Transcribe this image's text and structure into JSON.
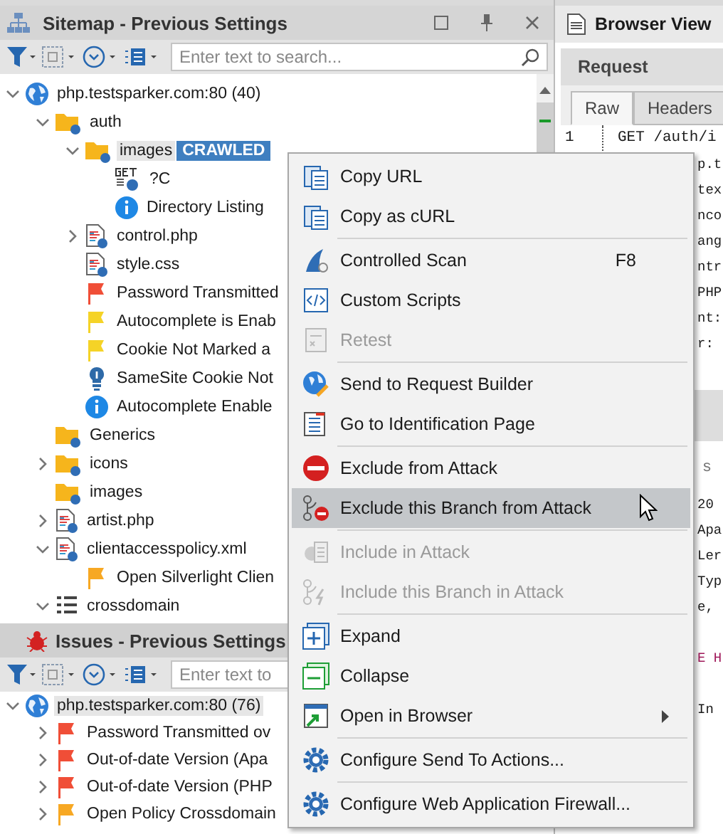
{
  "sitemap": {
    "title": "Sitemap - Previous Settings",
    "search": {
      "placeholder": "Enter text to search..."
    },
    "tree": [
      {
        "label": "php.testsparker.com:80 (40)",
        "kind": "globe",
        "expanded": true,
        "selected": false,
        "children": [
          {
            "label": "auth",
            "kind": "folder",
            "expanded": true,
            "selected": false,
            "children": [
              {
                "label": "images",
                "kind": "folder",
                "expanded": true,
                "selected": true,
                "badge": "CRAWLED",
                "children": [
                  {
                    "label": "?C",
                    "kind": "get",
                    "selected": false
                  },
                  {
                    "label": "Directory Listing",
                    "kind": "info",
                    "selected": false
                  }
                ]
              },
              {
                "label": "control.php",
                "kind": "page",
                "expanded": false,
                "selected": false
              },
              {
                "label": "style.css",
                "kind": "page",
                "selected": false
              },
              {
                "label": "Password Transmitted",
                "kind": "flag",
                "color": "#f04e37",
                "selected": false
              },
              {
                "label": "Autocomplete is Enab",
                "kind": "flag",
                "color": "#f5d327",
                "selected": false
              },
              {
                "label": "Cookie Not Marked a",
                "kind": "flag",
                "color": "#f5d327",
                "selected": false
              },
              {
                "label": "SameSite Cookie Not",
                "kind": "bulb",
                "selected": false
              },
              {
                "label": "Autocomplete Enable",
                "kind": "info",
                "selected": false
              }
            ]
          },
          {
            "label": "Generics",
            "kind": "folder",
            "selected": false
          },
          {
            "label": "icons",
            "kind": "folder",
            "expanded": false,
            "selected": false
          },
          {
            "label": "images",
            "kind": "folder",
            "selected": false
          },
          {
            "label": "artist.php",
            "kind": "page",
            "expanded": false,
            "selected": false
          },
          {
            "label": "clientaccesspolicy.xml",
            "kind": "page",
            "expanded": true,
            "selected": false,
            "children": [
              {
                "label": "Open Silverlight Clien",
                "kind": "flag",
                "color": "#f7a823",
                "selected": false
              }
            ]
          },
          {
            "label": "crossdomain",
            "kind": "list",
            "expanded": true,
            "selected": false
          }
        ]
      }
    ]
  },
  "issues": {
    "title": "Issues - Previous Settings",
    "search": {
      "placeholder": "Enter text to"
    },
    "tree": [
      {
        "label": "php.testsparker.com:80 (76)",
        "kind": "globe",
        "expanded": true,
        "selected": true,
        "children": [
          {
            "label": "Password Transmitted ov",
            "kind": "flag",
            "color": "#f04e37",
            "expanded": false,
            "selected": false
          },
          {
            "label": "Out-of-date Version (Apa",
            "kind": "flag",
            "color": "#f04e37",
            "expanded": false,
            "selected": false
          },
          {
            "label": "Out-of-date Version (PHP",
            "kind": "flag",
            "color": "#f04e37",
            "expanded": false,
            "selected": false
          },
          {
            "label": "Open Policy Crossdomain",
            "kind": "flag",
            "color": "#f7a823",
            "expanded": false,
            "selected": false
          }
        ]
      }
    ]
  },
  "browser": {
    "title": "Browser View",
    "request_title": "Request",
    "tabs": [
      {
        "label": "Raw",
        "selected": true
      },
      {
        "label": "Headers",
        "selected": false
      }
    ],
    "request_lines": [
      {
        "number": "1",
        "text": "GET /auth/i"
      },
      {
        "text": "p.t"
      },
      {
        "text": "tex"
      },
      {
        "text": "nco"
      },
      {
        "text": "ang"
      },
      {
        "text": "ntr"
      },
      {
        "text": "PHP"
      },
      {
        "text": "nt:"
      },
      {
        "text": "r:"
      }
    ],
    "response_search": "s",
    "response_lines": [
      {
        "text": "20"
      },
      {
        "text": "Apa"
      },
      {
        "text": "Ler"
      },
      {
        "text": "Typ"
      },
      {
        "text": "e,"
      },
      {
        "kind": "blank"
      },
      {
        "text": "E H",
        "kind": "tag"
      },
      {
        "kind": "blank"
      },
      {
        "text": "In"
      }
    ]
  },
  "context_menu": {
    "sections": [
      [
        {
          "label": "Copy URL",
          "disabled": false,
          "highlighted": false
        },
        {
          "label": "Copy as cURL",
          "disabled": false,
          "highlighted": false
        }
      ],
      [
        {
          "label": "Controlled Scan",
          "shortcut": "F8",
          "disabled": false,
          "highlighted": false
        },
        {
          "label": "Custom Scripts",
          "disabled": false,
          "highlighted": false
        },
        {
          "label": "Retest",
          "disabled": true,
          "highlighted": false
        }
      ],
      [
        {
          "label": "Send to Request Builder",
          "disabled": false,
          "highlighted": false
        },
        {
          "label": "Go to Identification Page",
          "disabled": false,
          "highlighted": false
        }
      ],
      [
        {
          "label": "Exclude from Attack",
          "disabled": false,
          "highlighted": false
        },
        {
          "label": "Exclude this Branch from Attack",
          "disabled": false,
          "highlighted": true
        }
      ],
      [
        {
          "label": "Include in Attack",
          "disabled": true,
          "highlighted": false
        },
        {
          "label": "Include this Branch in Attack",
          "disabled": true,
          "highlighted": false
        }
      ],
      [
        {
          "label": "Expand",
          "disabled": false,
          "highlighted": false
        },
        {
          "label": "Collapse",
          "disabled": false,
          "highlighted": false
        },
        {
          "label": "Open in Browser",
          "submenu": true,
          "disabled": false,
          "highlighted": false
        }
      ],
      [
        {
          "label": "Configure Send To Actions...",
          "disabled": false,
          "highlighted": false
        }
      ],
      [
        {
          "label": "Configure Web Application Firewall...",
          "disabled": false,
          "highlighted": false
        }
      ]
    ]
  }
}
